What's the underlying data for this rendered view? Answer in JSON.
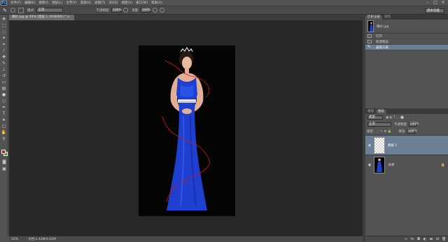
{
  "app": {
    "logo": "Ps"
  },
  "menu": [
    "文件(F)",
    "编辑(E)",
    "图像(I)",
    "图层(L)",
    "文字(Y)",
    "选择(S)",
    "滤镜(T)",
    "3D(D)",
    "视图(V)",
    "窗口(W)",
    "帮助(H)"
  ],
  "window_controls": {
    "minimize": "–",
    "maximize": "□",
    "close": "✕"
  },
  "options_bar": {
    "mode_label": "模式:",
    "mode_value": "正常",
    "opacity_label": "不透明度:",
    "opacity_value": "100%",
    "flow_label": "流量:",
    "flow_value": "100%",
    "workspace_value": "基本功能"
  },
  "document": {
    "tab_title": "婚纱.jpg @ 50% (图层 1, RGB/8#) *  ×",
    "zoom": "50%",
    "doc_size": "文档:2.42M/4.62M"
  },
  "colors": {
    "foreground": "#d01818",
    "background": "#22a022",
    "dress": "#1e3fd0",
    "selection": "#6d7f95"
  },
  "history": {
    "tabs": [
      "历史记录",
      "动作"
    ],
    "snapshot": "婚纱.jpg",
    "items": [
      "打开",
      "新建图层",
      "画笔工具"
    ]
  },
  "layers": {
    "tabs": [
      "通道",
      "图层"
    ],
    "kind_label": "类型",
    "blend_value": "正常",
    "opacity_label": "不透明度:",
    "opacity_value": "100%",
    "lock_label": "锁定:",
    "fill_label": "填充:",
    "fill_value": "100%",
    "items": [
      {
        "name": "图层 1"
      },
      {
        "name": "背景"
      }
    ]
  }
}
